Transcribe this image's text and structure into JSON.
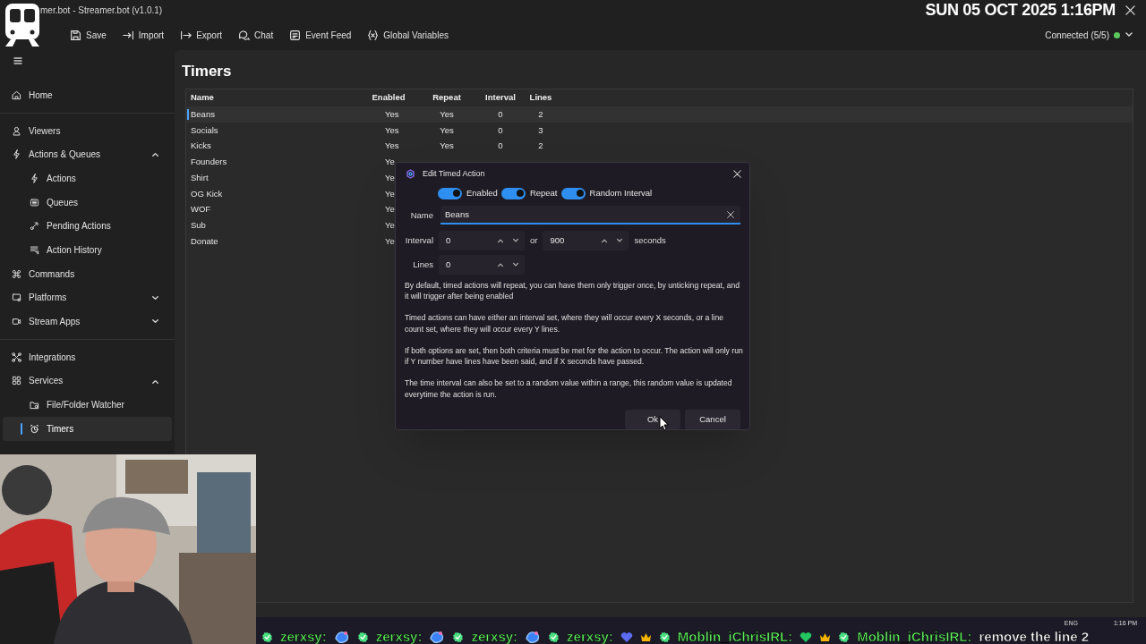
{
  "window": {
    "title": "mer.bot - Streamer.bot (v1.0.1)"
  },
  "overlay": {
    "datetime": "SUN 05 OCT 2025 1:16PM"
  },
  "toolbar": {
    "items": [
      {
        "kind": "save",
        "label": "Save"
      },
      {
        "kind": "import",
        "label": "Import"
      },
      {
        "kind": "export",
        "label": "Export"
      },
      {
        "kind": "chat",
        "label": "Chat"
      },
      {
        "kind": "feed",
        "label": "Event Feed"
      },
      {
        "kind": "variables",
        "label": "Global Variables"
      }
    ],
    "connection": {
      "label": "Connected (5/5)",
      "color": "#5cc85c"
    }
  },
  "sidebar": {
    "groups": [
      [
        {
          "kind": "home",
          "label": "Home",
          "selected": false
        }
      ],
      [
        {
          "kind": "person",
          "label": "Viewers",
          "selected": false
        },
        {
          "kind": "bolt",
          "label": "Actions & Queues",
          "selected": false,
          "expanded": true,
          "children": [
            {
              "kind": "bolt",
              "label": "Actions",
              "selected": false
            },
            {
              "kind": "queue",
              "label": "Queues",
              "selected": false
            },
            {
              "kind": "pending",
              "label": "Pending Actions",
              "selected": false
            },
            {
              "kind": "history",
              "label": "Action History",
              "selected": false
            }
          ]
        },
        {
          "kind": "command",
          "label": "Commands",
          "selected": false
        },
        {
          "kind": "monitor",
          "label": "Platforms",
          "selected": false,
          "expanded": false
        },
        {
          "kind": "camera",
          "label": "Stream Apps",
          "selected": false,
          "expanded": false
        }
      ],
      [
        {
          "kind": "integrations",
          "label": "Integrations",
          "selected": false
        },
        {
          "kind": "grid",
          "label": "Services",
          "selected": false,
          "expanded": true,
          "children": [
            {
              "kind": "folder",
              "label": "File/Folder Watcher",
              "selected": false
            },
            {
              "kind": "clock",
              "label": "Timers",
              "selected": true
            }
          ]
        }
      ]
    ]
  },
  "page": {
    "title": "Timers"
  },
  "table": {
    "columns": [
      "Name",
      "Enabled",
      "Repeat",
      "Interval",
      "Lines"
    ],
    "rows": [
      {
        "selected": true,
        "cells": [
          "Beans",
          "Yes",
          "Yes",
          "0",
          "2"
        ]
      },
      {
        "selected": false,
        "cells": [
          "Socials",
          "Yes",
          "Yes",
          "0",
          "3"
        ]
      },
      {
        "selected": false,
        "cells": [
          "Kicks",
          "Yes",
          "Yes",
          "0",
          "2"
        ]
      },
      {
        "selected": false,
        "cells": [
          "Founders",
          "Ye"
        ]
      },
      {
        "selected": false,
        "cells": [
          "Shirt",
          "Ye"
        ]
      },
      {
        "selected": false,
        "cells": [
          "OG Kick",
          "Ye"
        ]
      },
      {
        "selected": false,
        "cells": [
          "WOF",
          "Ye"
        ]
      },
      {
        "selected": false,
        "cells": [
          "Sub",
          "Ye"
        ]
      },
      {
        "selected": false,
        "cells": [
          "Donate",
          "Ye"
        ]
      }
    ]
  },
  "dialog": {
    "title": "Edit Timed Action",
    "toggles": [
      {
        "label": "Enabled",
        "on": true
      },
      {
        "label": "Repeat",
        "on": true
      },
      {
        "label": "Random Interval",
        "on": true
      }
    ],
    "name": {
      "label": "Name",
      "value": "Beans"
    },
    "interval": {
      "label": "Interval",
      "value": "0",
      "joiner": "or",
      "max_value": "900",
      "unit": "seconds"
    },
    "lines": {
      "label": "Lines",
      "value": "0"
    },
    "help": [
      "By default, timed actions will repeat, you can have them only trigger once, by unticking repeat, and it will trigger after being enabled",
      "Timed actions can have either an interval set, where they will occur every X seconds, or a line count set, where they will occur every Y lines.",
      "If both options are set, then both criteria must be met for the action to occur. The action will only run if Y number have lines have been said, and if X seconds have passed.",
      "The time interval can also be set to a random value within a range, this random value is updated everytime the action is run."
    ],
    "buttons": [
      "Ok",
      "Cancel"
    ]
  },
  "taskbar": {
    "language": "ENG",
    "time": "1:16 PM"
  },
  "chat_ticker": [
    {
      "user": "zerxsy:",
      "crown": false,
      "kind": "sticker"
    },
    {
      "user": "zerxsy:",
      "crown": false,
      "kind": "sticker"
    },
    {
      "user": "zerxsy:",
      "crown": false,
      "kind": "sticker"
    },
    {
      "user": "zerxsy:",
      "crown": false,
      "kind": "heart",
      "color": "#5b6cf0"
    },
    {
      "user": "Moblin_iChrisIRL:",
      "crown": true,
      "kind": "heart",
      "color": "#22c55e"
    },
    {
      "user": "Moblin_iChrisIRL:",
      "crown": true,
      "kind": "text",
      "message": "remove the line 2"
    }
  ]
}
